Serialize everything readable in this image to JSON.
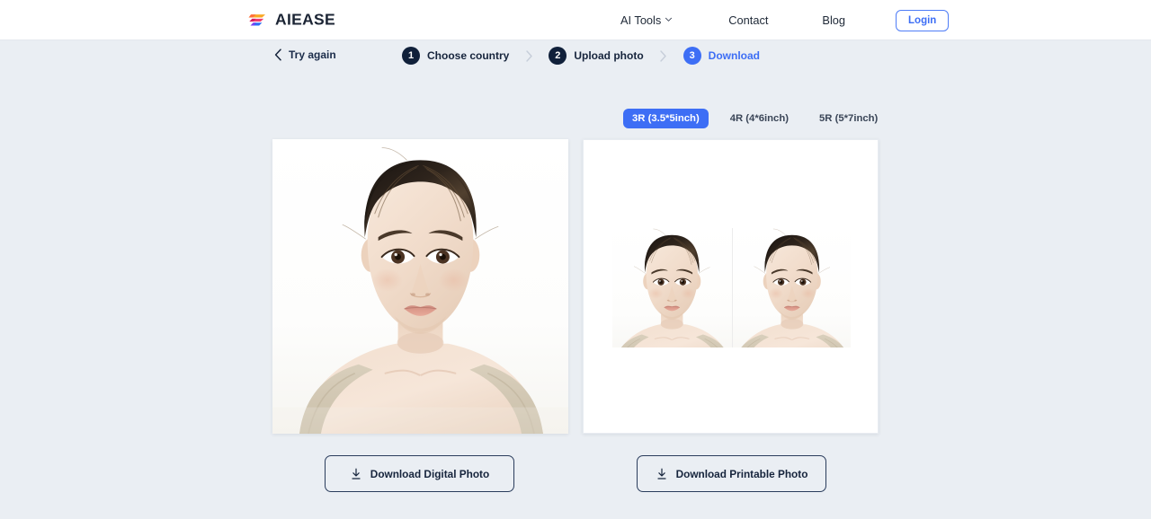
{
  "header": {
    "brand_name": "AIEASE",
    "brand_logo_icon": "aiease-stripes-logo",
    "nav": [
      {
        "label": "AI Tools",
        "icon": "chevron-down-icon",
        "has_caret": true
      },
      {
        "label": "Contact",
        "has_caret": false
      },
      {
        "label": "Blog",
        "has_caret": false
      }
    ],
    "login_label": "Login"
  },
  "stepper": {
    "back_icon": "chevron-left-icon",
    "back_label": "Try again",
    "separator_icon": "chevron-right-icon",
    "steps": [
      {
        "number": "1",
        "label": "Choose country",
        "state": "done"
      },
      {
        "number": "2",
        "label": "Upload photo",
        "state": "done"
      },
      {
        "number": "3",
        "label": "Download",
        "state": "active"
      }
    ]
  },
  "size_tabs": {
    "selected": "3R (3.5*5inch)",
    "options": [
      {
        "label": "3R (3.5*5inch)",
        "selected": true
      },
      {
        "label": "4R (4*6inch)",
        "selected": false
      },
      {
        "label": "5R (5*7inch)",
        "selected": false
      }
    ]
  },
  "preview": {
    "digital_panel_name": "digital-photo-preview",
    "printable_panel_name": "printable-photo-preview",
    "printable_copies": 2
  },
  "actions": {
    "download_digital_label": "Download Digital Photo",
    "download_printable_label": "Download Printable Photo",
    "download_icon": "download-icon"
  },
  "colors": {
    "page_background": "#eaeef3",
    "header_background": "#ffffff",
    "accent_blue": "#3d6ef5",
    "dark_navy": "#10203a",
    "text_dark": "#16243c"
  }
}
